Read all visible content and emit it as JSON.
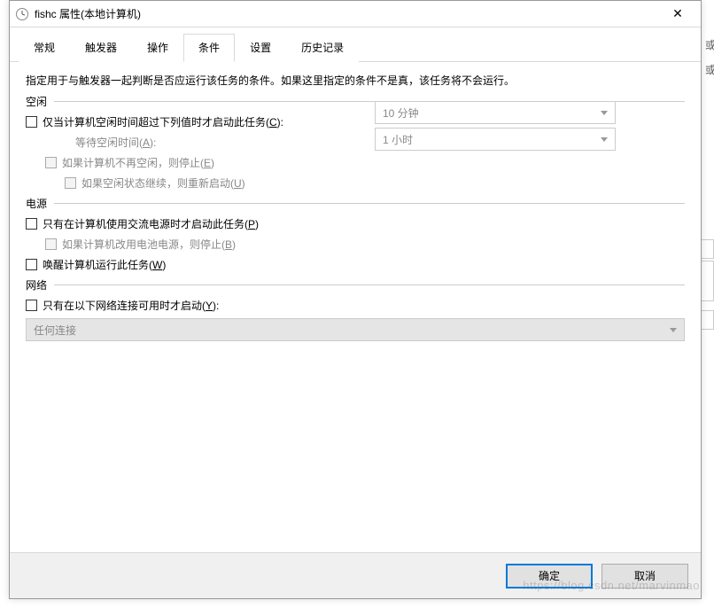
{
  "window": {
    "title": "fishc 属性(本地计算机)"
  },
  "tabs": {
    "general": "常规",
    "triggers": "触发器",
    "actions": "操作",
    "conditions": "条件",
    "settings": "设置",
    "history": "历史记录"
  },
  "content": {
    "description": "指定用于与触发器一起判断是否应运行该任务的条件。如果这里指定的条件不是真，该任务将不会运行。",
    "idle": {
      "section": "空闲",
      "start_if_idle_pre": "仅当计算机空闲时间超过下列值时才启动此任务(",
      "start_if_idle_key": "C",
      "start_if_idle_post": "):",
      "wait_pre": "等待空闲时间(",
      "wait_key": "A",
      "wait_post": "):",
      "stop_pre": "如果计算机不再空闲，则停止(",
      "stop_key": "E",
      "stop_post": ")",
      "restart_pre": "如果空闲状态继续，则重新启动(",
      "restart_key": "U",
      "restart_post": ")",
      "select_idle_duration": "10 分钟",
      "select_wait_duration": "1 小时"
    },
    "power": {
      "section": "电源",
      "ac_only_pre": "只有在计算机使用交流电源时才启动此任务(",
      "ac_only_key": "P",
      "ac_only_post": ")",
      "stop_battery_pre": "如果计算机改用电池电源，则停止(",
      "stop_battery_key": "B",
      "stop_battery_post": ")",
      "wake_pre": "唤醒计算机运行此任务(",
      "wake_key": "W",
      "wake_post": ")"
    },
    "network": {
      "section": "网络",
      "only_if_pre": "只有在以下网络连接可用时才启动(",
      "only_if_key": "Y",
      "only_if_post": "):",
      "select_value": "任何连接"
    }
  },
  "footer": {
    "ok": "确定",
    "cancel": "取消"
  },
  "outside": {
    "char1": "或",
    "char2": "或"
  },
  "watermark": "https://blog.csdn.net/marvinmao"
}
